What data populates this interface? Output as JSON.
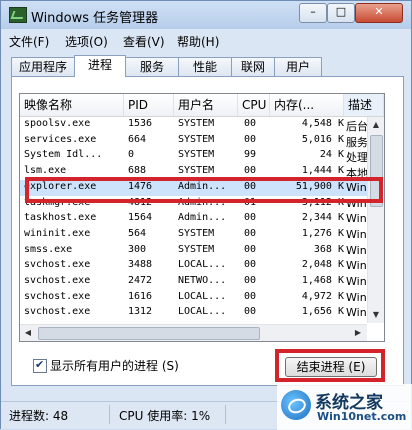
{
  "window": {
    "title": "Windows 任务管理器",
    "icon": "task-manager-icon",
    "controls": {
      "minimize": "–",
      "maximize": "□",
      "close": "✕"
    }
  },
  "menu": [
    "文件(F)",
    "选项(O)",
    "查看(V)",
    "帮助(H)"
  ],
  "tabs": [
    "应用程序",
    "进程",
    "服务",
    "性能",
    "联网",
    "用户"
  ],
  "active_tab": "进程",
  "process_table": {
    "columns": [
      "映像名称",
      "PID",
      "用户名",
      "CPU",
      "内存(...",
      "描述"
    ],
    "rows": [
      [
        "spoolsv.exe",
        "1536",
        "SYSTEM",
        "00",
        "4,548 K",
        "后台"
      ],
      [
        "services.exe",
        "664",
        "SYSTEM",
        "00",
        "5,016 K",
        "服务"
      ],
      [
        "System Idl...",
        "0",
        "SYSTEM",
        "99",
        "24 K",
        "处理"
      ],
      [
        "lsm.exe",
        "688",
        "SYSTEM",
        "00",
        "1,444 K",
        "本地"
      ],
      [
        "explorer.exe",
        "1476",
        "Admin...",
        "00",
        "51,900 K",
        "Win"
      ],
      [
        "taskmgr.exe",
        "4812",
        "Admin...",
        "01",
        "3,112 K",
        "Win"
      ],
      [
        "taskhost.exe",
        "1564",
        "Admin...",
        "00",
        "2,344 K",
        "Win"
      ],
      [
        "wininit.exe",
        "564",
        "SYSTEM",
        "00",
        "1,276 K",
        "Win"
      ],
      [
        "smss.exe",
        "300",
        "SYSTEM",
        "00",
        "368 K",
        "Win"
      ],
      [
        "svchost.exe",
        "3488",
        "LOCAL...",
        "00",
        "2,048 K",
        "Win"
      ],
      [
        "svchost.exe",
        "2472",
        "NETWO...",
        "00",
        "1,468 K",
        "Win"
      ],
      [
        "svchost.exe",
        "1616",
        "LOCAL...",
        "00",
        "4,972 K",
        "Win"
      ],
      [
        "svchost.exe",
        "1312",
        "LOCAL...",
        "00",
        "1,656 K",
        "Win"
      ]
    ],
    "selected_process": "explorer.exe"
  },
  "show_all_users": {
    "label": "显示所有用户的进程 (S)",
    "checked": true
  },
  "end_process_button": "结束进程 (E)",
  "status": {
    "process_count": "进程数: 48",
    "cpu_usage": "CPU 使用率: 1%"
  },
  "watermark": {
    "title": "系统之家",
    "url": "Win10net.com"
  },
  "colors": {
    "highlight": "#d3242b",
    "selection": "#cde3fb"
  }
}
